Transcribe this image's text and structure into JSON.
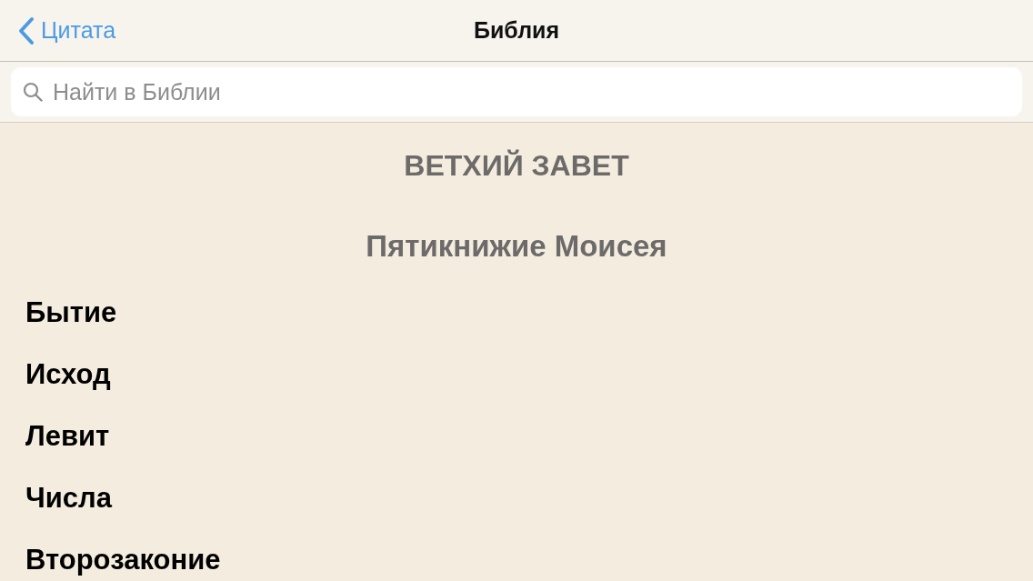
{
  "nav_bar": {
    "back_label": "Цитата",
    "title": "Библия"
  },
  "search": {
    "placeholder": "Найти в Библии"
  },
  "sections": [
    {
      "title": "ВЕТХИЙ ЗАВЕТ",
      "groups": [
        {
          "title": "Пятикнижие Моисея",
          "books": [
            "Бытие",
            "Исход",
            "Левит",
            "Числа",
            "Второзаконие"
          ]
        }
      ]
    }
  ]
}
